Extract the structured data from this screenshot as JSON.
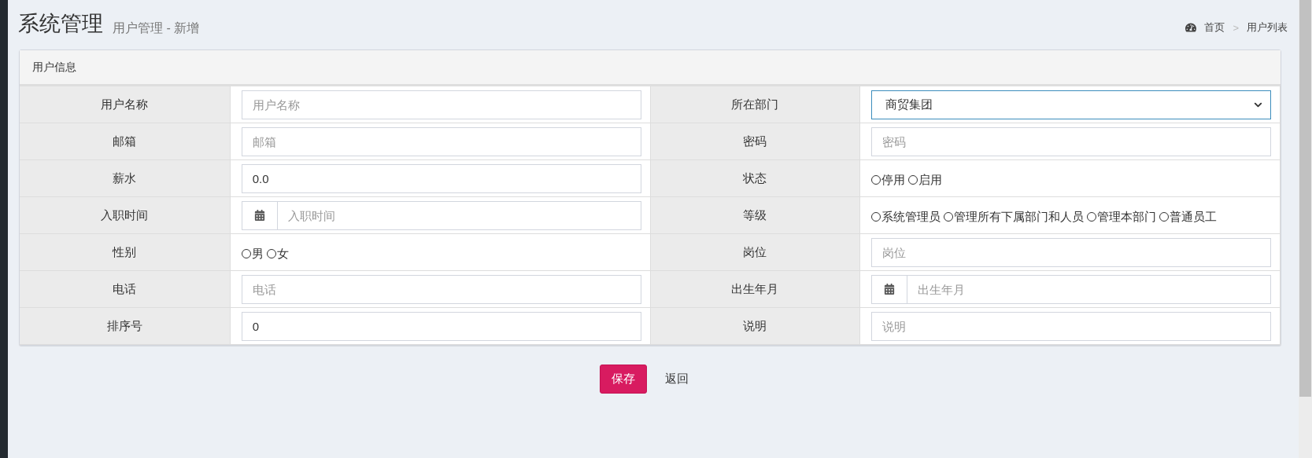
{
  "header": {
    "title": "系统管理",
    "subtitle": "用户管理 - 新增"
  },
  "breadcrumb": {
    "items": [
      {
        "label": "首页"
      },
      {
        "label": "用户列表"
      }
    ],
    "separator": ">"
  },
  "panel": {
    "title": "用户信息",
    "rows": [
      {
        "fields": [
          {
            "label": "用户名称",
            "kind": "text",
            "placeholder": "用户名称"
          },
          {
            "label": "所在部门",
            "kind": "select",
            "value": "商贸集团"
          }
        ]
      },
      {
        "fields": [
          {
            "label": "邮箱",
            "kind": "text",
            "placeholder": "邮箱"
          },
          {
            "label": "密码",
            "kind": "text",
            "placeholder": "密码"
          }
        ]
      },
      {
        "fields": [
          {
            "label": "薪水",
            "kind": "text",
            "value": "0.0"
          },
          {
            "label": "状态",
            "kind": "radio",
            "options": [
              {
                "label": "停用",
                "selected": false
              },
              {
                "label": "启用",
                "selected": false
              }
            ]
          }
        ]
      },
      {
        "fields": [
          {
            "label": "入职时间",
            "kind": "date",
            "placeholder": "入职时间"
          },
          {
            "label": "等级",
            "kind": "radio",
            "options": [
              {
                "label": "系统管理员",
                "selected": false
              },
              {
                "label": "管理所有下属部门和人员",
                "selected": false
              },
              {
                "label": "管理本部门",
                "selected": false
              },
              {
                "label": "普通员工",
                "selected": false
              }
            ]
          }
        ]
      },
      {
        "fields": [
          {
            "label": "性别",
            "kind": "radio",
            "options": [
              {
                "label": "男",
                "selected": false
              },
              {
                "label": "女",
                "selected": false
              }
            ]
          },
          {
            "label": "岗位",
            "kind": "text",
            "placeholder": "岗位"
          }
        ]
      },
      {
        "fields": [
          {
            "label": "电话",
            "kind": "text",
            "placeholder": "电话"
          },
          {
            "label": "出生年月",
            "kind": "date",
            "placeholder": "出生年月"
          }
        ]
      },
      {
        "fields": [
          {
            "label": "排序号",
            "kind": "text",
            "value": "0"
          },
          {
            "label": "说明",
            "kind": "text",
            "placeholder": "说明"
          }
        ]
      }
    ]
  },
  "buttons": [
    {
      "label": "保存",
      "kind": "primary"
    },
    {
      "label": "返回",
      "kind": "plain"
    }
  ]
}
